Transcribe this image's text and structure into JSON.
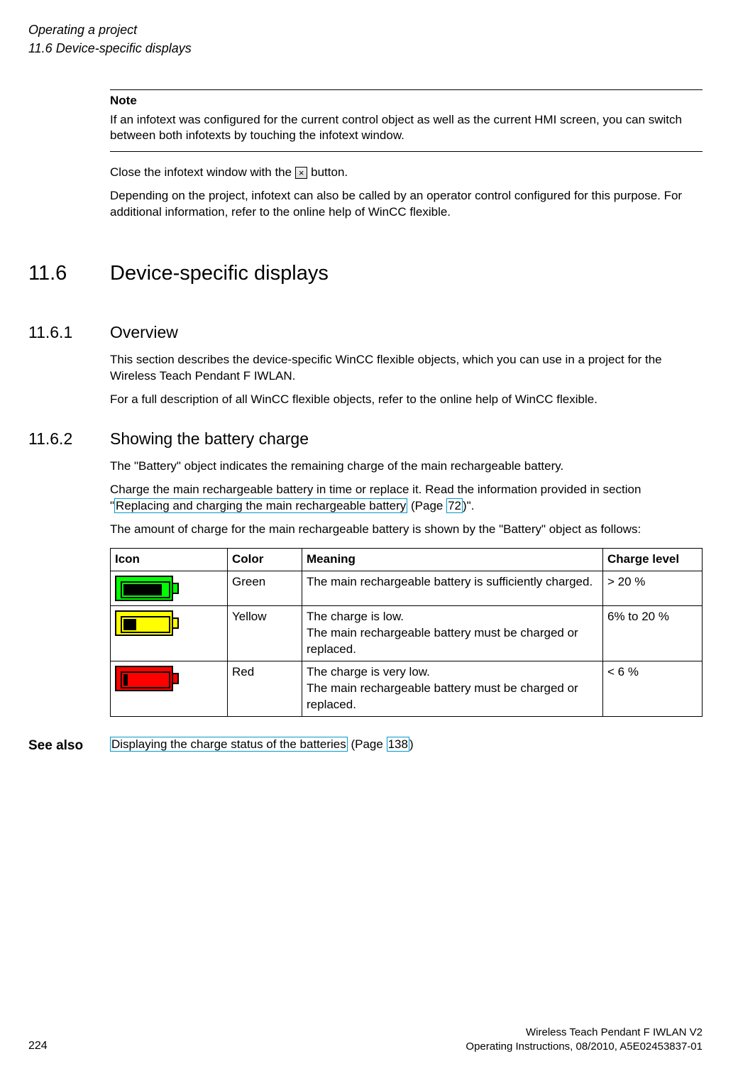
{
  "header": {
    "line1": "Operating a project",
    "line2": "11.6 Device-specific displays"
  },
  "note": {
    "label": "Note",
    "text": "If an infotext was configured for the current control object as well as the current HMI screen, you can switch between both infotexts by touching the infotext window."
  },
  "close_para_a": "Close the infotext window with the ",
  "close_btn": "×",
  "close_para_b": " button.",
  "depending_para": "Depending on the project, infotext can also be called by an operator control configured for this purpose. For additional information, refer to the online help of WinCC flexible.",
  "h1": {
    "num": "11.6",
    "title": "Device-specific displays"
  },
  "s1": {
    "num": "11.6.1",
    "title": "Overview",
    "p1": "This section describes the device-specific WinCC flexible objects, which you can use in a project for the Wireless Teach Pendant F IWLAN.",
    "p2": "For a full description of all WinCC flexible objects, refer to the online help of WinCC flexible."
  },
  "s2": {
    "num": "11.6.2",
    "title": "Showing the battery charge",
    "p1": "The \"Battery\" object indicates the remaining charge of the main rechargeable battery.",
    "p2a": "Charge the main rechargeable battery in time or replace it. Read the information provided in section \"",
    "p2_link": "Replacing and charging the main rechargeable battery",
    "p2b": " (Page ",
    "p2_page": "72",
    "p2c": ")\".",
    "p3": "The amount of charge for the main rechargeable battery is shown by the \"Battery\" object as follows:"
  },
  "table": {
    "head": {
      "c1": "Icon",
      "c2": "Color",
      "c3": "Meaning",
      "c4": "Charge level"
    },
    "rows": [
      {
        "color": "Green",
        "meaning": "The main rechargeable battery is sufficiently charged.",
        "level": "> 20 %"
      },
      {
        "color": "Yellow",
        "meaning_a": "The charge is low.",
        "meaning_b": "The main rechargeable battery must be charged or replaced.",
        "level": "6% to 20 %"
      },
      {
        "color": "Red",
        "meaning_a": "The charge is very low.",
        "meaning_b": "The main rechargeable battery must be charged or replaced.",
        "level": "< 6 %"
      }
    ]
  },
  "seealso": {
    "label": "See also",
    "link": "Displaying the charge status of the batteries",
    "mid": " (Page ",
    "page": "138",
    "end": ")"
  },
  "footer": {
    "r1": "Wireless Teach Pendant F IWLAN V2",
    "r2": "Operating Instructions, 08/2010, A5E02453837-01",
    "pagenum": "224"
  }
}
